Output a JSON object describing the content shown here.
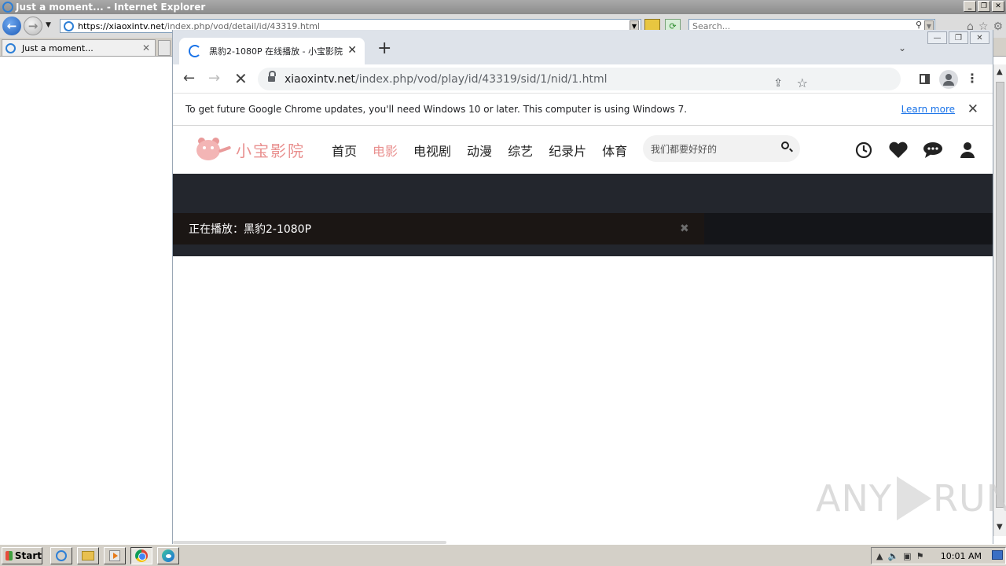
{
  "ie": {
    "window_title": "Just a moment... - Internet Explorer",
    "address_host": "https://xiaoxintv.net",
    "address_path": "/index.php/vod/detail/id/43319.html",
    "search_placeholder": "Search...",
    "tab_label": "Just a moment..."
  },
  "chrome": {
    "tab_title": "黑豹2-1080P 在线播放 - 小宝影院 -",
    "url_host": "xiaoxintv.net",
    "url_path": "/index.php/vod/play/id/43319/sid/1/nid/1.html",
    "infobar_text": "To get future Google Chrome updates, you'll need Windows 10 or later. This computer is using Windows 7.",
    "infobar_link": "Learn more"
  },
  "site": {
    "logo_text": "小宝影院",
    "nav": [
      "首页",
      "电影",
      "电视剧",
      "动漫",
      "综艺",
      "纪录片",
      "体育"
    ],
    "active_nav": "电影",
    "search_placeholder": "我们都要好好的",
    "now_playing": "正在播放：黑豹2-1080P",
    "accent_color": "#e9908f"
  },
  "taskbar": {
    "start_label": "Start",
    "clock": "10:01 AM"
  },
  "watermark": {
    "left": "ANY",
    "right": "RUN"
  }
}
